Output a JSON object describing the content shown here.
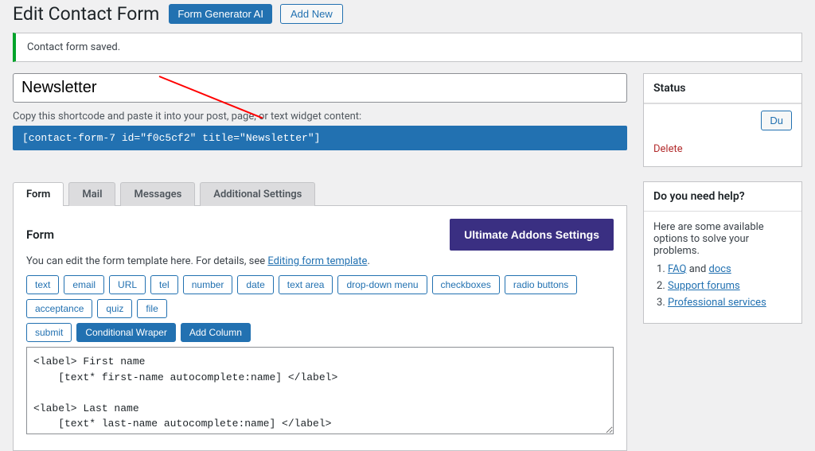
{
  "header": {
    "title": "Edit Contact Form",
    "form_gen_btn": "Form Generator AI",
    "add_new_btn": "Add New"
  },
  "notice": "Contact form saved.",
  "form_title": "Newsletter",
  "shortcode_hint": "Copy this shortcode and paste it into your post, page, or text widget content:",
  "shortcode": "[contact-form-7 id=\"f0c5cf2\" title=\"Newsletter\"]",
  "tabs": [
    {
      "label": "Form",
      "active": true
    },
    {
      "label": "Mail",
      "active": false
    },
    {
      "label": "Messages",
      "active": false
    },
    {
      "label": "Additional Settings",
      "active": false
    }
  ],
  "panel": {
    "title": "Form",
    "ultimate_btn": "Ultimate Addons Settings",
    "desc_prefix": "You can edit the form template here. For details, see ",
    "desc_link": "Editing form template",
    "desc_suffix": ".",
    "tag_buttons_row1": [
      "text",
      "email",
      "URL",
      "tel",
      "number",
      "date",
      "text area",
      "drop-down menu",
      "checkboxes",
      "radio buttons",
      "acceptance",
      "quiz",
      "file"
    ],
    "tag_buttons_row2": [
      {
        "label": "submit",
        "filled": false
      },
      {
        "label": "Conditional Wraper",
        "filled": true
      },
      {
        "label": "Add Column",
        "filled": true
      }
    ],
    "code": "<label> First name\n    [text* first-name autocomplete:name] </label>\n\n<label> Last name\n    [text* last-name autocomplete:name] </label>"
  },
  "sidebar": {
    "status": {
      "title": "Status",
      "duplicate": "Du",
      "delete": "Delete"
    },
    "help": {
      "title": "Do you need help?",
      "intro": "Here are some available options to solve your problems.",
      "items": [
        {
          "prefix": "",
          "links": [
            "FAQ"
          ],
          "mid": " and ",
          "links2": [
            "docs"
          ]
        },
        {
          "prefix": "",
          "links": [
            "Support forums"
          ]
        },
        {
          "prefix": "",
          "links": [
            "Professional services"
          ]
        }
      ]
    }
  }
}
